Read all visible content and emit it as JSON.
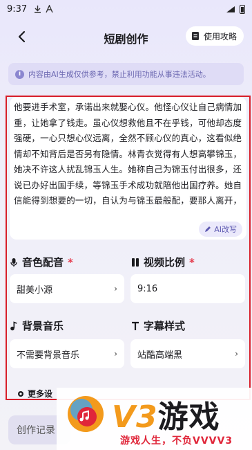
{
  "status_bar": {
    "time": "9:37",
    "left_icons": [
      "download-icon",
      "a-icon"
    ],
    "right_icons": [
      "signal-icon",
      "battery-icon"
    ]
  },
  "nav": {
    "title": "短剧创作",
    "guide_label": "使用攻略",
    "icons": [
      "back-arrow-icon",
      "guide-doc-icon"
    ]
  },
  "notice": {
    "text": "内容由AI生成仅供参考，禁止利用功能从事违法活动。",
    "icon": "info-icon"
  },
  "script": {
    "text": "他要进手术室，承诺出来就娶心仪。他怪心仪让自己病情加重，让她拿了钱走。虽心仪想救他且不在乎钱，可他却态度强硬，一心只想心仪远离，全然不顾心仪的真心，这看似绝情却不知背后是否另有隐情。林青衣觉得有人想高攀锦玉，她决不许这人扰乱锦玉人生。她称自己为锦玉付出很多，还说已办好出国手续，等锦玉手术成功就陪他出国疗养。她自信能得到想要的一切，自认为与锦玉最般配，要那人离开，可她只强势，却不知锦玉醒来后是否真会如她所愿，手",
    "ai_rewrite_label": "AI改写"
  },
  "voice": {
    "label": "音色配音",
    "required_mark": "*",
    "value": "甜美小源",
    "icon": "microphone-icon"
  },
  "ratio": {
    "label": "视频比例",
    "required_mark": "*",
    "value": "9:16",
    "icon": "ratio-icon"
  },
  "bgm": {
    "label": "背景音乐",
    "value": "不需要背景音乐",
    "icon": "music-note-icon"
  },
  "subtitle": {
    "label": "字幕样式",
    "value": "站酷高端黑",
    "icon": "text-t-icon"
  },
  "more": {
    "label": "更多设",
    "icon": "gear-icon"
  },
  "records": {
    "label": "创作记录"
  },
  "watermark": {
    "brand_v3": "V3",
    "brand_cn": "游戏",
    "slogan": "游戏人生，不负VVVV3"
  },
  "colors": {
    "accent": "#6a66b0",
    "required": "#e4394b",
    "highlight_border": "#d81e2a",
    "watermark_orange": "#f39a1c",
    "watermark_red": "#e0263a"
  }
}
